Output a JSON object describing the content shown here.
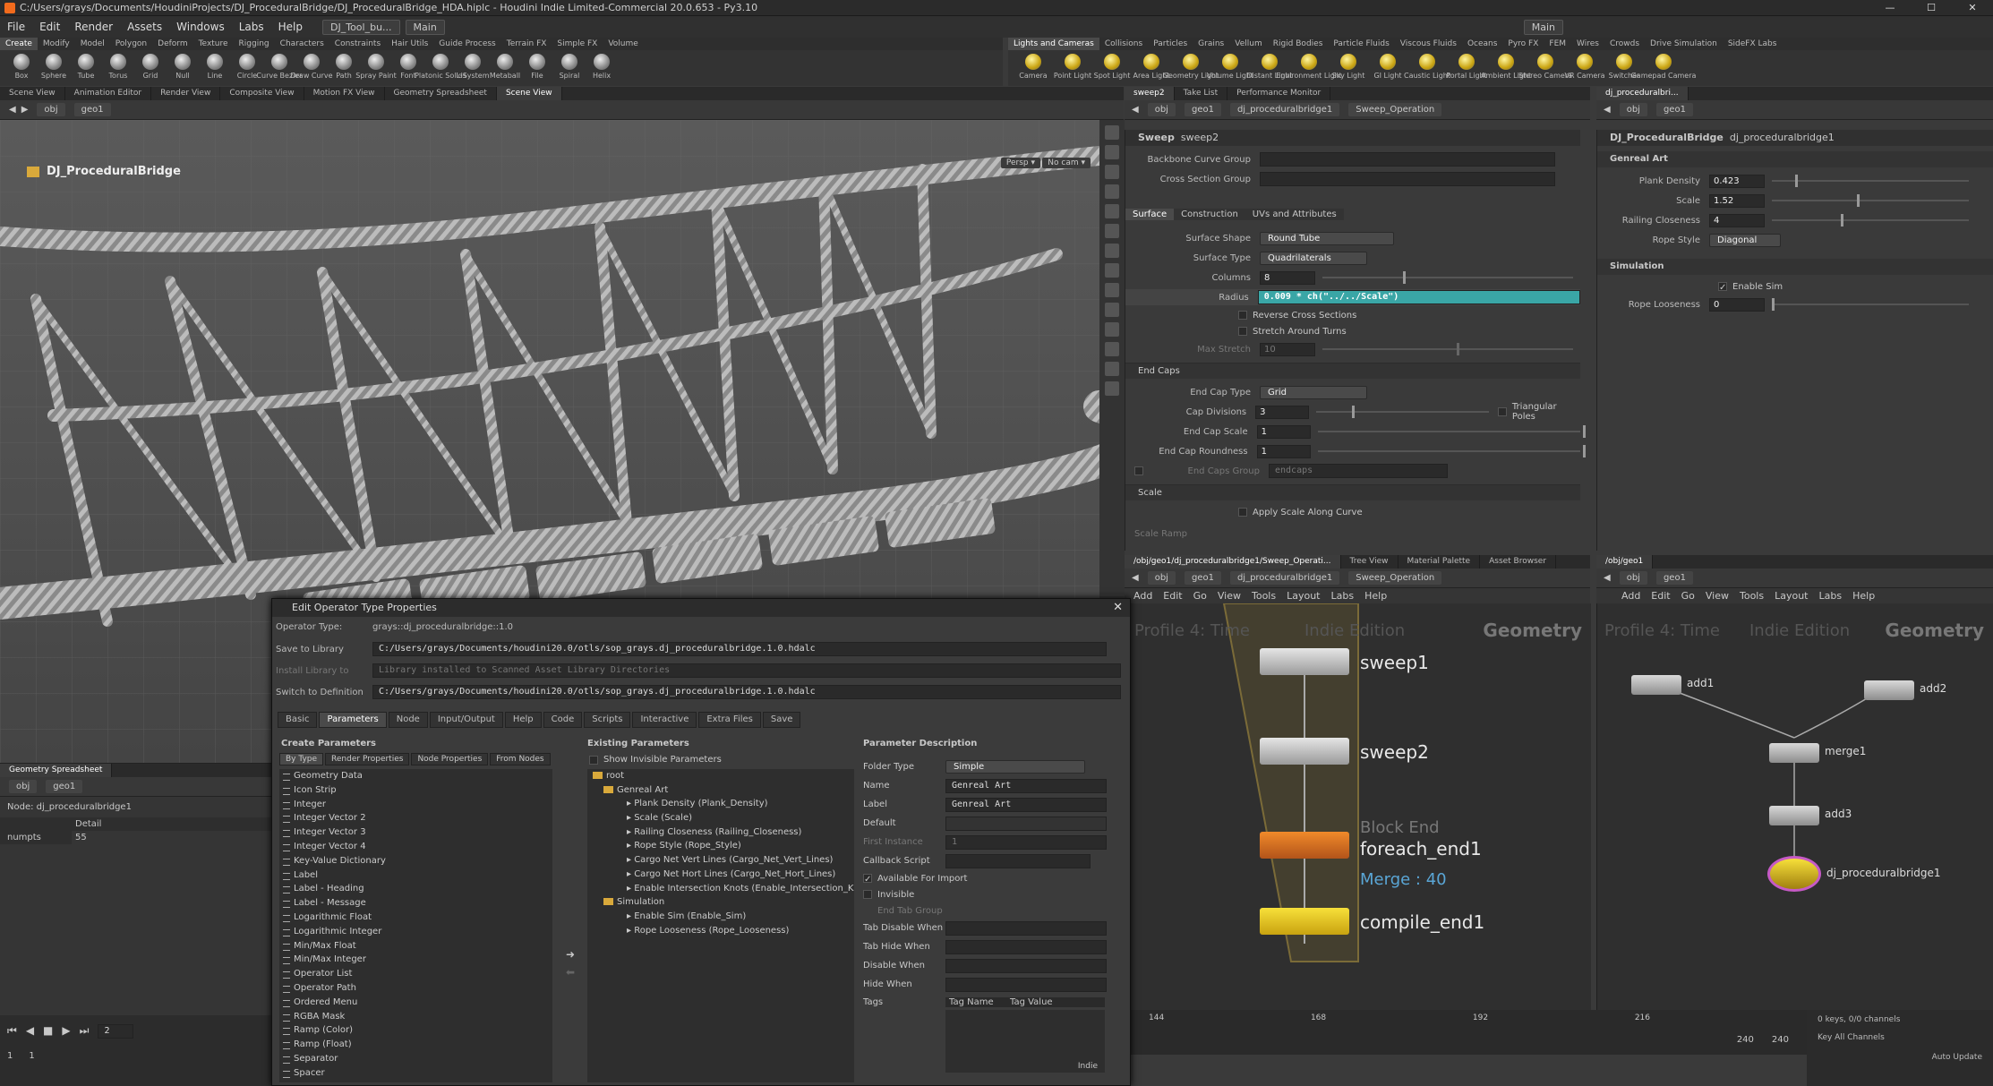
{
  "window": {
    "title": "C:/Users/grays/Documents/HoudiniProjects/DJ_ProceduralBridge/DJ_ProceduralBridge_HDA.hiplc - Houdini Indie Limited-Commercial 20.0.653 - Py3.10",
    "controls": [
      "—",
      "☐",
      "✕"
    ]
  },
  "menubar": {
    "items": [
      "File",
      "Edit",
      "Render",
      "Assets",
      "Windows",
      "Labs",
      "Help"
    ],
    "desktop": "DJ_Tool_bu...",
    "workspace": "Main",
    "right_workspace": "Main"
  },
  "shelf_tabs": [
    "Create",
    "Modify",
    "Model",
    "Polygon",
    "Deform",
    "Texture",
    "Rigging",
    "Characters",
    "Constraints",
    "Hair Utils",
    "Guide Process",
    "Terrain FX",
    "Simple FX",
    "Volume"
  ],
  "shelf_tabs2": [
    "Lights and Cameras",
    "Collisions",
    "Particles",
    "Grains",
    "Vellum",
    "Rigid Bodies",
    "Particle Fluids",
    "Viscous Fluids",
    "Oceans",
    "Pyro FX",
    "FEM",
    "Wires",
    "Crowds",
    "Drive Simulation",
    "SideFX Labs"
  ],
  "shelf_tools": [
    "Box",
    "Sphere",
    "Tube",
    "Torus",
    "Grid",
    "Null",
    "Line",
    "Circle",
    "Curve Bezier",
    "Draw Curve",
    "Path",
    "Spray Paint",
    "Font",
    "Platonic Solids",
    "L-System",
    "Metaball",
    "File",
    "Spiral",
    "Helix"
  ],
  "shelf_tools2": [
    "Camera",
    "Point Light",
    "Spot Light",
    "Area Light",
    "Geometry Light",
    "Volume Light",
    "Distant Light",
    "Environment Light",
    "Sky Light",
    "GI Light",
    "Caustic Light",
    "Portal Light",
    "Ambient Light",
    "Stereo Camera",
    "VR Camera",
    "Switcher",
    "Gamepad Camera"
  ],
  "pane_tabs_left": [
    "Scene View",
    "Animation Editor",
    "Render View",
    "Composite View",
    "Motion FX View",
    "Geometry Spreadsheet",
    "Scene View"
  ],
  "pane_tabs_mid": [
    "sweep2",
    "Take List",
    "Performance Monitor"
  ],
  "pane_tabs_right": [
    "dj_proceduralbri..."
  ],
  "viewport": {
    "path_obj": "obj",
    "path_geo": "geo1",
    "title": "DJ_ProceduralBridge",
    "persp": "Persp ▾",
    "cam": "No cam ▾"
  },
  "sweep_panel": {
    "path_obj": "obj",
    "path_geo": "geo1",
    "path_hda": "dj_proceduralbridge1",
    "path_op": "Sweep_Operation",
    "node_type": "Sweep",
    "node_name": "sweep2",
    "backbone_label": "Backbone Curve Group",
    "cross_label": "Cross Section Group",
    "tabs": [
      "Surface",
      "Construction",
      "UVs and Attributes"
    ],
    "surface_shape_label": "Surface Shape",
    "surface_shape": "Round Tube",
    "surface_type_label": "Surface Type",
    "surface_type": "Quadrilaterals",
    "columns_label": "Columns",
    "columns": "8",
    "radius_label": "Radius",
    "radius": "0.009 * ch(\"../../Scale\")",
    "reverse_label": "Reverse Cross Sections",
    "stretch_label": "Stretch Around Turns",
    "maxstretch_label": "Max Stretch",
    "maxstretch": "10",
    "endcaps_section": "End Caps",
    "endcaptype_label": "End Cap Type",
    "endcaptype": "Grid",
    "capdiv_label": "Cap Divisions",
    "capdiv": "3",
    "tripoles_label": "Triangular Poles",
    "capscale_label": "End Cap Scale",
    "capscale": "1",
    "caproundness_label": "End Cap Roundness",
    "caproundness": "1",
    "capsgroup_label": "End Caps Group",
    "capsgroup": "endcaps",
    "scale_section": "Scale",
    "applyscale_label": "Apply Scale Along Curve",
    "scaleramp_label": "Scale Ramp"
  },
  "dj_panel": {
    "path_obj": "obj",
    "path_geo": "geo1",
    "node_type": "DJ_ProceduralBridge",
    "node_name": "dj_proceduralbridge1",
    "folder1": "Genreal Art",
    "plank_label": "Plank Density",
    "plank": "0.423",
    "plank_level": 0.12,
    "scale_label": "Scale",
    "scale": "1.52",
    "scale_level": 0.43,
    "railing_label": "Railing Closeness",
    "railing": "4",
    "railing_level": 0.35,
    "rope_label": "Rope Style",
    "rope": "Diagonal",
    "folder2": "Simulation",
    "enablesim_label": "Enable Sim",
    "ropeloose_label": "Rope Looseness",
    "ropeloose": "0",
    "ropeloose_level": 0.0
  },
  "net_left": {
    "pathbar_tab": "/obj/geo1/dj_proceduralbridge1/Sweep_Operati...",
    "tabs": [
      "Tree View",
      "Material Palette",
      "Asset Browser"
    ],
    "path_obj": "obj",
    "path_geo": "geo1",
    "path_hda": "dj_proceduralbridge1",
    "path_op": "Sweep_Operation",
    "menu": [
      "Add",
      "Edit",
      "Go",
      "View",
      "Tools",
      "Layout",
      "Labs",
      "Help"
    ],
    "watermark1": "Profile 4: Time",
    "watermark2": "Indie Edition",
    "context": "Geometry",
    "nodes": [
      "sweep1",
      "sweep2",
      "foreach_end1",
      "compile_end1"
    ],
    "block_end": "Block End",
    "merge_note": "Merge : 40"
  },
  "net_right": {
    "pathbar_tab": "/obj/geo1",
    "path_obj": "obj",
    "path_geo": "geo1",
    "menu": [
      "Add",
      "Edit",
      "Go",
      "View",
      "Tools",
      "Layout",
      "Labs",
      "Help"
    ],
    "watermark1": "Profile 4: Time",
    "watermark2": "Indie Edition",
    "context": "Geometry",
    "nodes": [
      "add1",
      "add2",
      "merge1",
      "add3",
      "dj_proceduralbridge1"
    ]
  },
  "dialog": {
    "title": "Edit Operator Type Properties",
    "optype_label": "Operator Type:",
    "optype": "grays::dj_proceduralbridge::1.0",
    "save_label": "Save to Library",
    "save_path": "C:/Users/grays/Documents/houdini20.0/otls/sop_grays.dj_proceduralbridge.1.0.hdalc",
    "install_label": "Install Library to",
    "install_value": "Library installed to Scanned Asset Library Directories",
    "switch_label": "Switch to Definition",
    "switch_value": "C:/Users/grays/Documents/houdini20.0/otls/sop_grays.dj_proceduralbridge.1.0.hdalc",
    "tabs": [
      "Basic",
      "Parameters",
      "Node",
      "Input/Output",
      "Help",
      "Code",
      "Scripts",
      "Interactive",
      "Extra Files",
      "Save"
    ],
    "create_params": "Create Parameters",
    "create_tabs": [
      "By Type",
      "Render Properties",
      "Node Properties",
      "From Nodes"
    ],
    "types": [
      "Geometry Data",
      "Icon Strip",
      "Integer",
      "Integer Vector 2",
      "Integer Vector 3",
      "Integer Vector 4",
      "Key-Value Dictionary",
      "Label",
      "Label - Heading",
      "Label - Message",
      "Logarithmic Float",
      "Logarithmic Integer",
      "Min/Max Float",
      "Min/Max Integer",
      "Operator List",
      "Operator Path",
      "Ordered Menu",
      "RGBA Mask",
      "Ramp (Color)",
      "Ramp (Float)",
      "Separator",
      "Spacer"
    ],
    "existing_params": "Existing Parameters",
    "show_invisible": "Show Invisible Parameters",
    "tree_root": "root",
    "tree_folder1": "Genreal Art",
    "tree_items1": [
      "Plank Density (Plank_Density)",
      "Scale (Scale)",
      "Railing Closeness (Railing_Closeness)",
      "Rope Style (Rope_Style)",
      "Cargo Net Vert Lines (Cargo_Net_Vert_Lines)",
      "Cargo Net Hort Lines (Cargo_Net_Hort_Lines)",
      "Enable Intersection Knots (Enable_Intersection_Knot"
    ],
    "tree_folder2": "Simulation",
    "tree_items2": [
      "Enable Sim (Enable_Sim)",
      "Rope Looseness (Rope_Looseness)"
    ],
    "param_desc": "Parameter Description",
    "folder_type_label": "Folder Type",
    "folder_type": "Simple",
    "name_label": "Name",
    "name_value": "Genreal Art",
    "label_label": "Label",
    "label_value": "Genreal Art",
    "default_label": "Default",
    "first_instance_label": "First Instance",
    "first_instance": "1",
    "callback_label": "Callback Script",
    "available_label": "Available For Import",
    "invisible_label": "Invisible",
    "endtab_label": "End Tab Group",
    "tabdisable_label": "Tab Disable When",
    "tabhide_label": "Tab Hide When",
    "disable_label": "Disable When",
    "hide_label": "Hide When",
    "tags_label": "Tags",
    "tag_name": "Tag Name",
    "tag_value": "Tag Value",
    "tag_footer": "Indie"
  },
  "sheet": {
    "tab": "Geometry Spreadsheet",
    "path_obj": "obj",
    "path_geo": "geo1",
    "node_line": "Node: dj_proceduralbridge1",
    "col": "Detail",
    "row_label": "numpts",
    "row_value": "55"
  },
  "timeline": {
    "frame": "2",
    "start": "1",
    "start2": "1",
    "ticks": [
      "144",
      "168",
      "192",
      "216"
    ],
    "end": "240",
    "end2": "240",
    "keys": "0 keys, 0/0 channels",
    "key_all": "Key All Channels",
    "auto_update": "Auto Update"
  }
}
